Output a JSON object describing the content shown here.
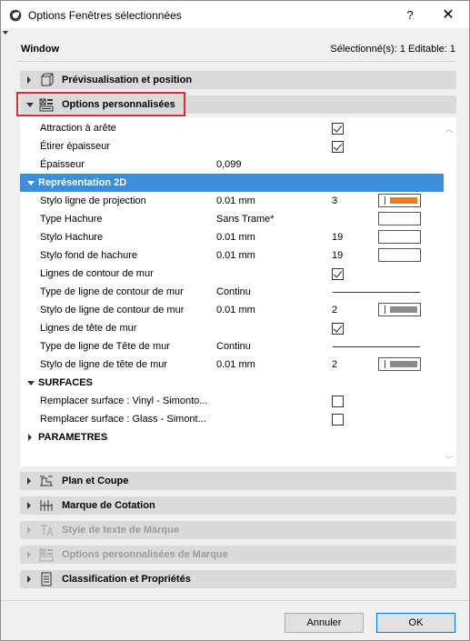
{
  "window": {
    "title": "Options Fenêtres sélectionnées",
    "help": "?",
    "close": "✕"
  },
  "context": {
    "label": "Window",
    "selection": "Sélectionné(s): 1 Editable: 1"
  },
  "sections": {
    "preview": "Prévisualisation et position",
    "custom": "Options personnalisées",
    "plan": "Plan et Coupe",
    "dim": "Marque de Cotation",
    "text_style": "Style de texte de Marque",
    "marker_custom": "Options personnalisées de Marque",
    "classification": "Classification et Propriétés"
  },
  "props": {
    "snap_edge": "Attraction à arête",
    "stretch_thickness": "Étirer épaisseur",
    "thickness": "Épaisseur",
    "thickness_value": "0,099",
    "rep2d": "Représentation 2D",
    "proj_pen": "Stylo ligne de projection",
    "proj_pen_val": "0.01 mm",
    "proj_pen_num": "3",
    "hatch_type": "Type Hachure",
    "hatch_type_val": "Sans Trame*",
    "hatch_pen": "Stylo Hachure",
    "hatch_pen_val": "0.01 mm",
    "hatch_pen_num": "19",
    "hatch_bg_pen": "Stylo fond de hachure",
    "hatch_bg_pen_val": "0.01 mm",
    "hatch_bg_pen_num": "19",
    "wall_contour": "Lignes de contour de mur",
    "wall_contour_type": "Type de ligne de contour de mur",
    "wall_contour_type_val": "Continu",
    "wall_contour_pen": "Stylo de ligne de contour de mur",
    "wall_contour_pen_val": "0.01 mm",
    "wall_contour_pen_num": "2",
    "wall_head": "Lignes de tête de mur",
    "wall_head_type": "Type de ligne de Tête de mur",
    "wall_head_type_val": "Continu",
    "wall_head_pen": "Stylo de ligne de tête de mur",
    "wall_head_pen_val": "0.01 mm",
    "wall_head_pen_num": "2",
    "surfaces": "SURFACES",
    "surface_vinyl": "Remplacer surface : Vinyl - Simonto...",
    "surface_glass": "Remplacer surface : Glass - Simont...",
    "parametres": "PARAMETRES"
  },
  "buttons": {
    "cancel": "Annuler",
    "ok": "OK"
  },
  "colors": {
    "orange_pen": "#f07a1a",
    "gray_pen": "#8a8a8a",
    "selection_blue": "#3b8ed8",
    "highlight_red": "#e8262b"
  }
}
